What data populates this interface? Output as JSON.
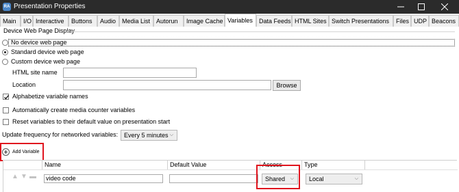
{
  "window": {
    "icon_text": "RA",
    "title": "Presentation Properties",
    "min_icon": "minimize-icon",
    "max_icon": "maximize-icon",
    "close_icon": "close-icon"
  },
  "tabs": [
    {
      "label": "Main"
    },
    {
      "label": "I/O"
    },
    {
      "label": "Interactive"
    },
    {
      "label": "Buttons"
    },
    {
      "label": "Audio"
    },
    {
      "label": "Media List"
    },
    {
      "label": "Autorun"
    },
    {
      "label": "Image Cache"
    },
    {
      "label": "Variables",
      "active": true
    },
    {
      "label": "Data Feeds"
    },
    {
      "label": "HTML Sites"
    },
    {
      "label": "Switch Presentations"
    },
    {
      "label": "Files"
    },
    {
      "label": "UDP"
    },
    {
      "label": "Beacons"
    }
  ],
  "device_web_page": {
    "group_label": "Device Web Page Display",
    "option_none": "No device web page",
    "option_standard": "Standard device web page",
    "option_custom": "Custom device web page",
    "selected": "standard",
    "html_site_label": "HTML site name",
    "html_site_value": "",
    "location_label": "Location",
    "location_value": "",
    "browse_label": "Browse"
  },
  "options": {
    "alphabetize_label": "Alphabetize variable names",
    "alphabetize_checked": true,
    "auto_counter_label": "Automatically create media counter variables",
    "auto_counter_checked": false,
    "reset_label": "Reset variables to their default value on presentation start",
    "reset_checked": false,
    "update_freq_label": "Update frequency for networked variables:",
    "update_freq_value": "Every 5 minutes"
  },
  "add_variable": {
    "label": "Add Variable",
    "icon": "plus-circle-icon"
  },
  "grid": {
    "columns": [
      "Name",
      "Default Value",
      "Access",
      "Type"
    ],
    "rows": [
      {
        "name": "video code",
        "default_value": "",
        "access": "Shared",
        "type": "Local"
      }
    ]
  },
  "highlight_color": "#e0141e"
}
